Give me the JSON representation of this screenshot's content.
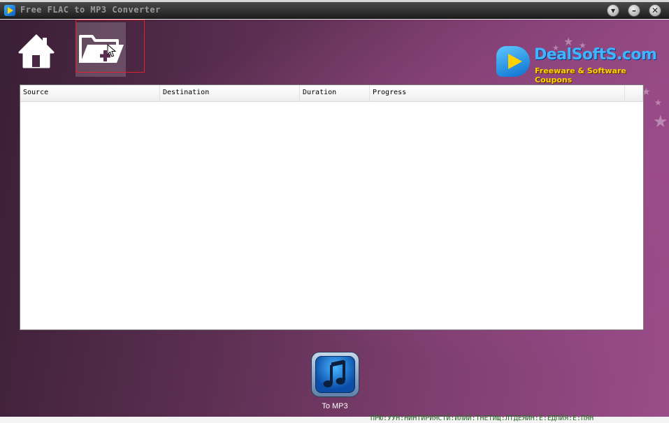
{
  "window": {
    "title": "Free FLAC to MP3 Converter",
    "buttons": {
      "dropdown": "▾",
      "minimize": "–",
      "close": "✕"
    }
  },
  "toolbar": {
    "home_icon": "home-icon",
    "add_files_icon": "folder-add-icon"
  },
  "logo": {
    "name": "DealSoftS.com",
    "tagline": "Freeware & Software Coupons"
  },
  "file_list": {
    "columns": [
      "Source",
      "Destination",
      "Duration",
      "Progress",
      ""
    ],
    "rows": []
  },
  "convert": {
    "label": "To MP3",
    "icon": "music-note-icon"
  },
  "behind": {
    "bottom_text": "ПРЮ:УУН:НИНТИРИЯСТЙ:ИЛИЙ:ТНЕТИЩ:ЛТДЕЯЙН:Е:ЕДПЙЯ:Е:ПЯН"
  },
  "colors": {
    "accent_red": "#e0202a",
    "logo_blue": "#3fb4ff",
    "logo_yellow": "#ffd200"
  }
}
